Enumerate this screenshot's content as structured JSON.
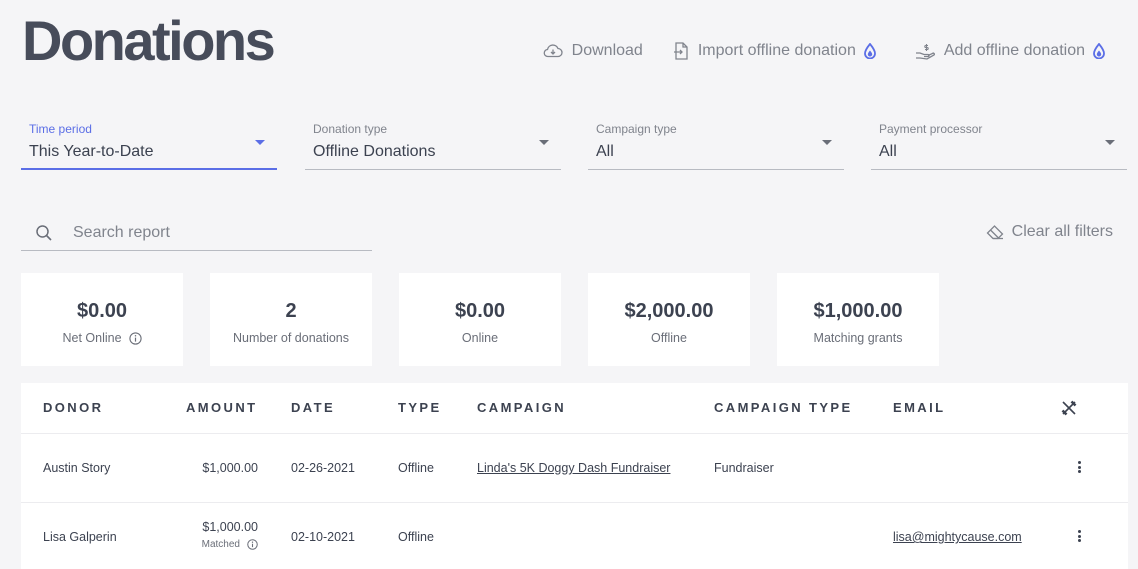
{
  "page": {
    "title": "Donations"
  },
  "actions": {
    "download": "Download",
    "import_offline": "Import offline donation",
    "add_offline": "Add offline donation"
  },
  "filters": [
    {
      "label": "Time period",
      "value": "This Year-to-Date"
    },
    {
      "label": "Donation type",
      "value": "Offline Donations"
    },
    {
      "label": "Campaign type",
      "value": "All"
    },
    {
      "label": "Payment processor",
      "value": "All"
    }
  ],
  "search": {
    "placeholder": "Search report"
  },
  "clear_filters": "Clear all filters",
  "summary": [
    {
      "value": "$0.00",
      "label": "Net Online"
    },
    {
      "value": "2",
      "label": "Number of donations"
    },
    {
      "value": "$0.00",
      "label": "Online"
    },
    {
      "value": "$2,000.00",
      "label": "Offline"
    },
    {
      "value": "$1,000.00",
      "label": "Matching grants"
    }
  ],
  "table": {
    "columns": [
      "DONOR",
      "AMOUNT",
      "DATE",
      "TYPE",
      "CAMPAIGN",
      "CAMPAIGN TYPE",
      "EMAIL"
    ],
    "rows": [
      {
        "donor": "Austin Story",
        "amount": "$1,000.00",
        "date": "02-26-2021",
        "type": "Offline",
        "campaign": "Linda's 5K Doggy Dash Fundraiser",
        "campaign_type": "Fundraiser",
        "email": ""
      },
      {
        "donor": "Lisa Galperin",
        "amount": "$1,000.00",
        "note": "Matched",
        "date": "02-10-2021",
        "type": "Offline",
        "campaign": "",
        "campaign_type": "",
        "email": "lisa@mightycause.com"
      }
    ]
  },
  "colors": {
    "accent": "#5b6ee6",
    "text": "#3c4250",
    "muted": "#80848d",
    "background": "#f5f5f7"
  }
}
